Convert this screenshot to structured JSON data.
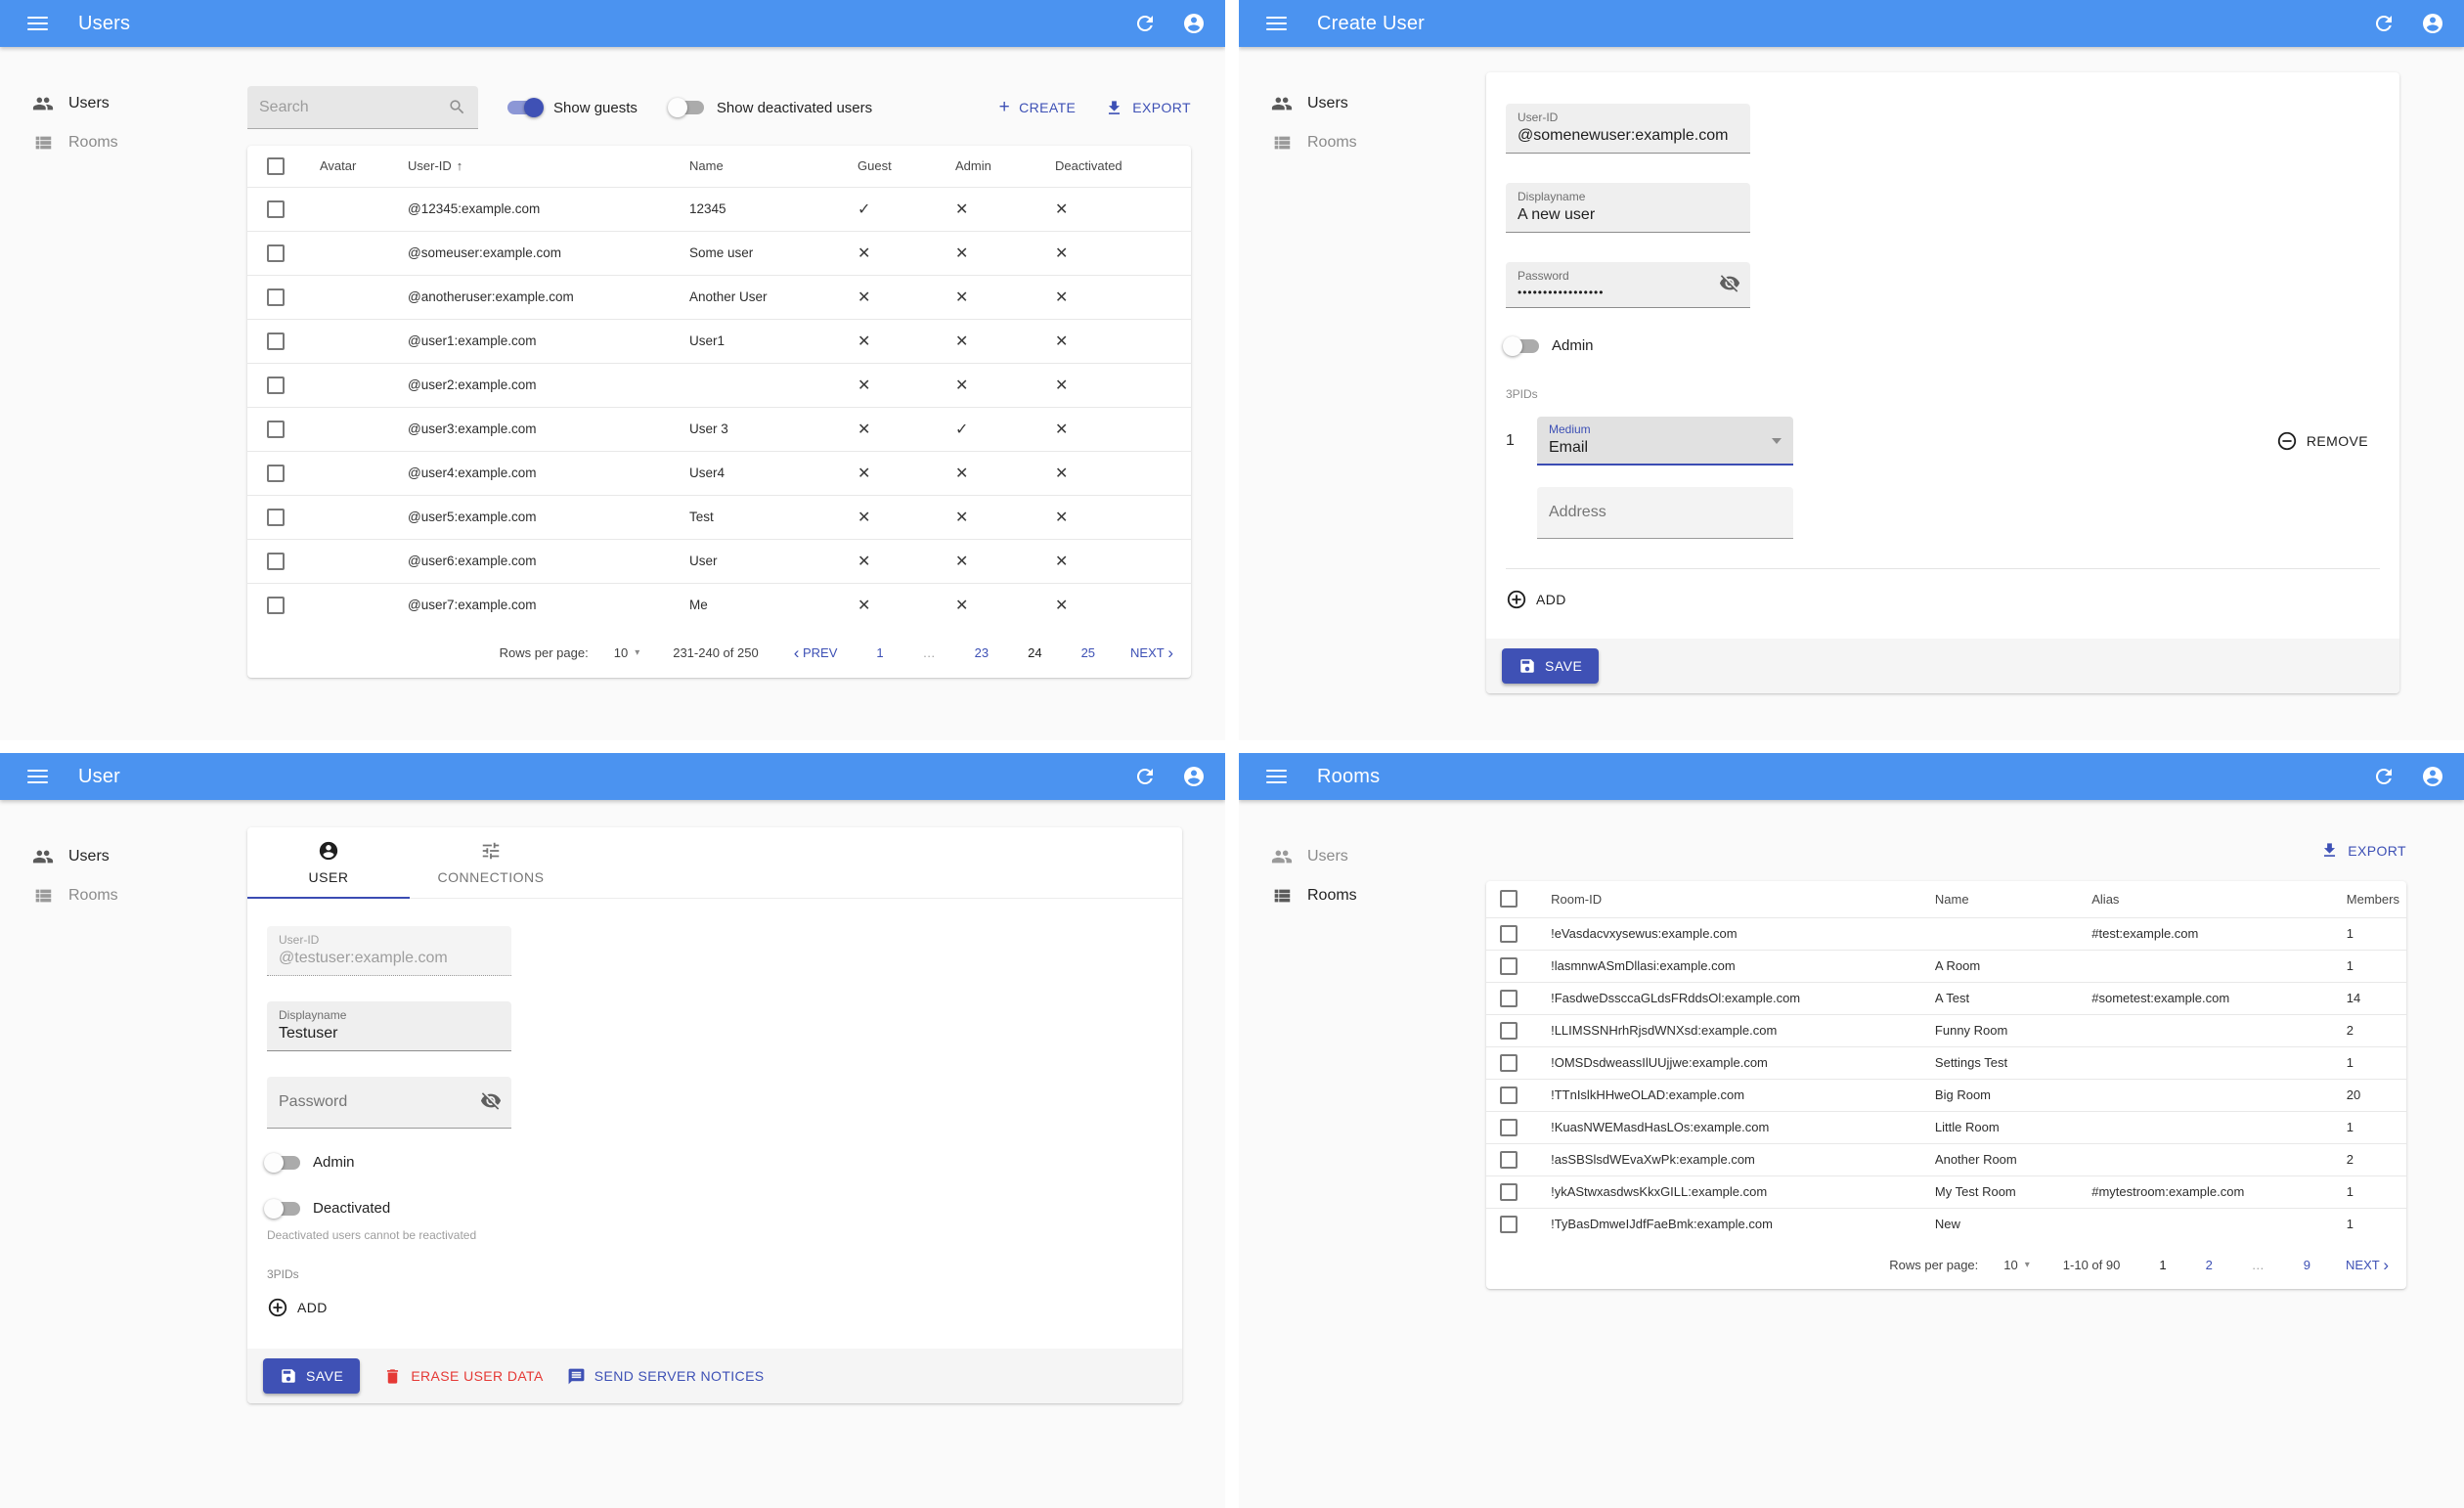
{
  "icons": {
    "sort_asc": "↑",
    "caret_down": "▾",
    "chevron_left": "‹",
    "chevron_right": "›",
    "plus": "+"
  },
  "users_list": {
    "title": "Users",
    "sidebar": {
      "users": "Users",
      "rooms": "Rooms"
    },
    "search_placeholder": "Search",
    "toggles": {
      "show_guests": "Show guests",
      "show_deactivated": "Show deactivated users"
    },
    "actions": {
      "create": "CREATE",
      "export": "EXPORT"
    },
    "table": {
      "headers": {
        "avatar": "Avatar",
        "user_id": "User-ID",
        "name": "Name",
        "guest": "Guest",
        "admin": "Admin",
        "deactivated": "Deactivated"
      },
      "rows": [
        {
          "user_id": "@12345:example.com",
          "name": "12345",
          "guest": "✓",
          "admin": "✕",
          "deactivated": "✕"
        },
        {
          "user_id": "@someuser:example.com",
          "name": "Some user",
          "guest": "✕",
          "admin": "✕",
          "deactivated": "✕"
        },
        {
          "user_id": "@anotheruser:example.com",
          "name": "Another User",
          "guest": "✕",
          "admin": "✕",
          "deactivated": "✕"
        },
        {
          "user_id": "@user1:example.com",
          "name": "User1",
          "guest": "✕",
          "admin": "✕",
          "deactivated": "✕"
        },
        {
          "user_id": "@user2:example.com",
          "name": "",
          "guest": "✕",
          "admin": "✕",
          "deactivated": "✕"
        },
        {
          "user_id": "@user3:example.com",
          "name": "User 3",
          "guest": "✕",
          "admin": "✓",
          "deactivated": "✕"
        },
        {
          "user_id": "@user4:example.com",
          "name": "User4",
          "guest": "✕",
          "admin": "✕",
          "deactivated": "✕"
        },
        {
          "user_id": "@user5:example.com",
          "name": "Test",
          "guest": "✕",
          "admin": "✕",
          "deactivated": "✕"
        },
        {
          "user_id": "@user6:example.com",
          "name": "User",
          "guest": "✕",
          "admin": "✕",
          "deactivated": "✕"
        },
        {
          "user_id": "@user7:example.com",
          "name": "Me",
          "guest": "✕",
          "admin": "✕",
          "deactivated": "✕"
        }
      ]
    },
    "pagination": {
      "label": "Rows per page:",
      "per_page": "10",
      "range": "231-240 of 250",
      "prev": "PREV",
      "next": "NEXT",
      "pages": [
        "1",
        "…",
        "23",
        "24",
        "25"
      ]
    }
  },
  "create_user": {
    "title": "Create User",
    "sidebar": {
      "users": "Users",
      "rooms": "Rooms"
    },
    "fields": {
      "user_id": {
        "label": "User-ID",
        "value": "@somenewuser:example.com"
      },
      "displayname": {
        "label": "Displayname",
        "value": "A new user"
      },
      "password": {
        "label": "Password",
        "value": "•••••••••••••••••"
      }
    },
    "admin_label": "Admin",
    "threepids": {
      "label": "3PIDs",
      "index": "1",
      "medium": {
        "label": "Medium",
        "value": "Email"
      },
      "address_placeholder": "Address",
      "remove": "REMOVE",
      "add": "ADD"
    },
    "save": "SAVE"
  },
  "user_edit": {
    "title": "User",
    "sidebar": {
      "users": "Users",
      "rooms": "Rooms"
    },
    "tabs": {
      "user": "USER",
      "connections": "CONNECTIONS"
    },
    "fields": {
      "user_id": {
        "label": "User-ID",
        "value": "@testuser:example.com"
      },
      "displayname": {
        "label": "Displayname",
        "value": "Testuser"
      },
      "password_placeholder": "Password"
    },
    "admin_label": "Admin",
    "deactivated_label": "Deactivated",
    "helper": "Deactivated users cannot be reactivated",
    "threepids_label": "3PIDs",
    "add": "ADD",
    "actions": {
      "save": "SAVE",
      "erase": "ERASE USER DATA",
      "notices": "SEND SERVER NOTICES"
    }
  },
  "rooms_list": {
    "title": "Rooms",
    "sidebar": {
      "users": "Users",
      "rooms": "Rooms"
    },
    "export": "EXPORT",
    "table": {
      "headers": {
        "room_id": "Room-ID",
        "name": "Name",
        "alias": "Alias",
        "members": "Members"
      },
      "rows": [
        {
          "room_id": "!eVasdacvxysewus:example.com",
          "name": "",
          "alias": "#test:example.com",
          "members": "1"
        },
        {
          "room_id": "!lasmnwASmDllasi:example.com",
          "name": "A Room",
          "alias": "",
          "members": "1"
        },
        {
          "room_id": "!FasdweDssccaGLdsFRddsOl:example.com",
          "name": "A Test",
          "alias": "#sometest:example.com",
          "members": "14"
        },
        {
          "room_id": "!LLIMSSNHrhRjsdWNXsd:example.com",
          "name": "Funny Room",
          "alias": "",
          "members": "2"
        },
        {
          "room_id": "!OMSDsdweassIlUUjjwe:example.com",
          "name": "Settings Test",
          "alias": "",
          "members": "1"
        },
        {
          "room_id": "!TTnIslkHHweOLAD:example.com",
          "name": "Big Room",
          "alias": "",
          "members": "20"
        },
        {
          "room_id": "!KuasNWEMasdHasLOs:example.com",
          "name": "Little Room",
          "alias": "",
          "members": "1"
        },
        {
          "room_id": "!asSBSlsdWEvaXwPk:example.com",
          "name": "Another Room",
          "alias": "",
          "members": "2"
        },
        {
          "room_id": "!ykAStwxasdwsKkxGILL:example.com",
          "name": "My Test Room",
          "alias": "#mytestroom:example.com",
          "members": "1"
        },
        {
          "room_id": "!TyBasDmweIJdfFaeBmk:example.com",
          "name": "New",
          "alias": "",
          "members": "1"
        }
      ]
    },
    "pagination": {
      "label": "Rows per page:",
      "per_page": "10",
      "range": "1-10 of 90",
      "next": "NEXT",
      "pages": [
        "1",
        "2",
        "…",
        "9"
      ]
    }
  }
}
